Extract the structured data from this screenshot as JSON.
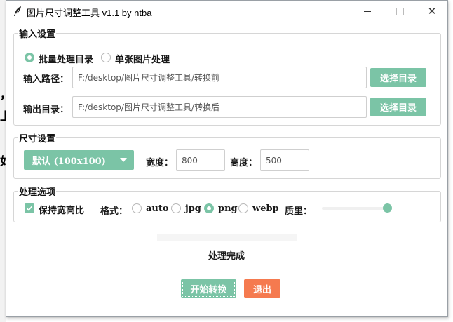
{
  "background": {
    "char1": "，",
    "char2": "上",
    "char3": "如"
  },
  "window": {
    "title": "图片尺寸调整工具 v1.1 by ntba",
    "controls": {
      "minimize": "—",
      "maximize": "☐",
      "close": "✕"
    }
  },
  "input_settings": {
    "legend": "输入设置",
    "mode_batch": "批量处理目录",
    "mode_single": "单张图片处理",
    "input_path_label": "输入路径：",
    "input_path_value": "F:/desktop/图片尺寸调整工具/转换前",
    "input_browse": "选择目录",
    "output_dir_label": "输出目录：",
    "output_dir_value": "F:/desktop/图片尺寸调整工具/转换后",
    "output_browse": "选择目录"
  },
  "size_settings": {
    "legend": "尺寸设置",
    "preset_selected": "默认 (100x100)",
    "width_label": "宽度：",
    "width_value": "800",
    "height_label": "高度：",
    "height_value": "500"
  },
  "options": {
    "legend": "处理选项",
    "keep_ratio_label": "保持宽高比",
    "keep_ratio_checked": true,
    "format_label": "格式：",
    "formats": [
      "auto",
      "jpg",
      "png",
      "webp"
    ],
    "format_selected": "png",
    "quality_label": "质里：",
    "quality_level": 1.0
  },
  "status": {
    "text": "处理完成",
    "progress": 0
  },
  "actions": {
    "start": "开始转换",
    "exit": "退出"
  },
  "colors": {
    "accent": "#7bc4a6",
    "danger": "#f57a4f"
  }
}
